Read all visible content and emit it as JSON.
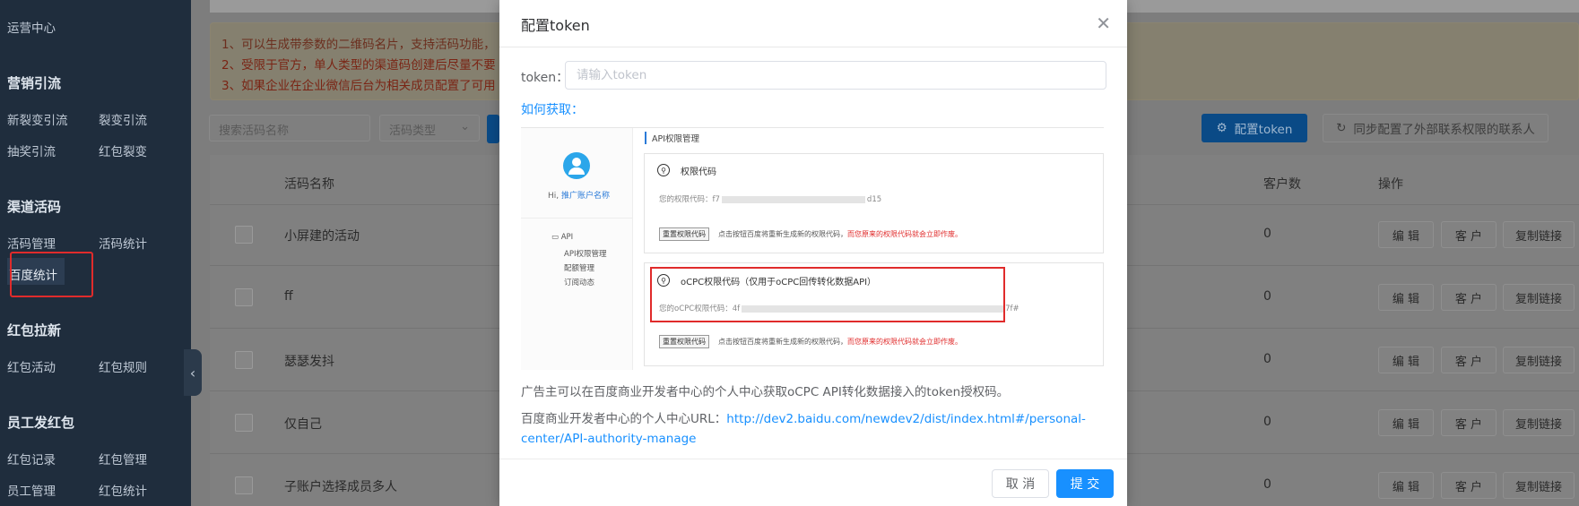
{
  "sidebar": {
    "top_item": "运营中心",
    "groups": [
      {
        "title": "营销引流",
        "items": [
          "新裂变引流",
          "裂变引流",
          "抽奖引流",
          "红包裂变"
        ]
      },
      {
        "title": "渠道活码",
        "items": [
          "活码管理",
          "活码统计",
          "百度统计"
        ]
      },
      {
        "title": "红包拉新",
        "items": [
          "红包活动",
          "红包规则"
        ]
      },
      {
        "title": "员工发红包",
        "items": [
          "红包记录",
          "红包管理",
          "员工管理",
          "红包统计"
        ]
      }
    ],
    "active_item": "百度统计"
  },
  "background": {
    "notice_lines": [
      "1、可以生成带参数的二维码名片，支持活码功能，",
      "2、受限于官方，单人类型的渠道码创建后尽量不要",
      "3、如果企业在企业微信后台为相关成员配置了可用"
    ],
    "search_placeholder": "搜索活码名称",
    "type_select": "活码类型",
    "config_token_btn": "配置token",
    "sync_btn": "同步配置了外部联系权限的联系人",
    "table_headers": [
      "活码名称",
      "客户数",
      "操作"
    ],
    "rows": [
      {
        "name": "小屏建的活动",
        "count": "0"
      },
      {
        "name": "ff",
        "count": "0"
      },
      {
        "name": "瑟瑟发抖",
        "count": "0"
      },
      {
        "name": "仅自己",
        "count": "0"
      },
      {
        "name": "子账户选择成员多人",
        "count": "0"
      }
    ],
    "row_actions": [
      "编 辑",
      "客 户",
      "复制链接"
    ]
  },
  "modal": {
    "title": "配置token",
    "token_label": "token：",
    "token_placeholder": "请输入token",
    "how_to": "如何获取：",
    "screenshot": {
      "greeting_prefix": "Hi,",
      "greeting_name": "推广账户名称",
      "menu": [
        "API",
        "API权限管理",
        "配额管理",
        "订阅动态"
      ],
      "section_title": "API权限管理",
      "card1_title": "权限代码",
      "card1_code_prefix": "您的权限代码：",
      "card1_code_start": "f7",
      "card1_code_end": "d15",
      "card2_title": "oCPC权限代码（仅用于oCPC回传转化数据API）",
      "card2_code_prefix": "您的oCPC权限代码：",
      "card2_code_start": "4f",
      "card2_code_end": "7f#",
      "reset_btn": "重置权限代码",
      "reset_text": "点击按钮百度将重新生成新的权限代码，",
      "reset_warn": "而您原来的权限代码就会立即作废。"
    },
    "description": "广告主可以在百度商业开发者中心的个人中心获取oCPC API转化数据接入的token授权码。",
    "url_label": "百度商业开发者中心的个人中心URL：",
    "url": "http://dev2.baidu.com/newdev2/dist/index.html#/personal-center/API-authority-manage",
    "cancel": "取 消",
    "submit": "提 交"
  }
}
